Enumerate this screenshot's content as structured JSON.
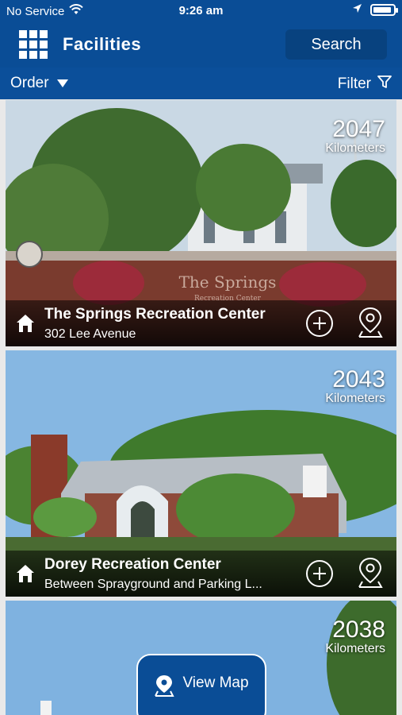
{
  "status_bar": {
    "carrier": "No Service",
    "time": "9:26 am",
    "battery_level": 0.8
  },
  "nav": {
    "title": "Facilities",
    "search_label": "Search"
  },
  "subbar": {
    "order_label": "Order",
    "filter_label": "Filter"
  },
  "facilities": [
    {
      "distance": "2047",
      "unit": "Kilometers",
      "name": "The Springs Recreation Center",
      "address": "302 Lee Avenue",
      "sign_text": "The Springs",
      "sign_sub": "Recreation Center"
    },
    {
      "distance": "2043",
      "unit": "Kilometers",
      "name": "Dorey Recreation Center",
      "address": "Between Sprayground and Parking L..."
    },
    {
      "distance": "2038",
      "unit": "Kilometers"
    }
  ],
  "view_map_label": "View Map",
  "colors": {
    "brand_blue": "#0a4d96",
    "dark_blue": "#08427f"
  }
}
